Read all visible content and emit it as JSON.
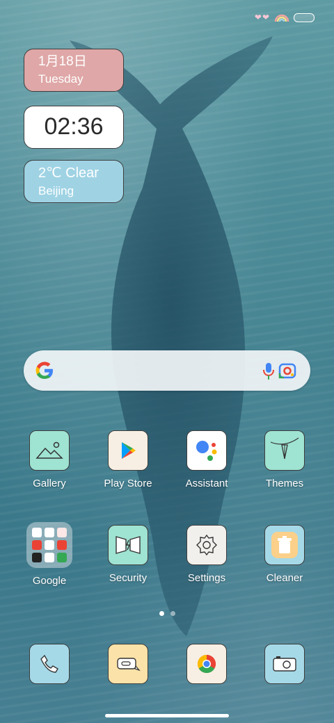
{
  "widgets": {
    "date": {
      "date": "1月18日",
      "weekday": "Tuesday"
    },
    "clock": {
      "time": "02:36"
    },
    "weather": {
      "condition": "2℃ Clear",
      "city": "Beijing"
    }
  },
  "search": {
    "logo_icon": "google-g-icon",
    "voice_icon": "mic-icon",
    "lens_icon": "google-lens-icon"
  },
  "apps": [
    {
      "label": "Gallery",
      "icon": "gallery-icon"
    },
    {
      "label": "Play Store",
      "icon": "play-store-icon"
    },
    {
      "label": "Assistant",
      "icon": "assistant-icon"
    },
    {
      "label": "Themes",
      "icon": "themes-icon"
    },
    {
      "label": "Google",
      "icon": "folder-icon"
    },
    {
      "label": "Security",
      "icon": "security-icon"
    },
    {
      "label": "Settings",
      "icon": "settings-icon"
    },
    {
      "label": "Cleaner",
      "icon": "cleaner-icon"
    }
  ],
  "dock": [
    {
      "icon": "phone-icon"
    },
    {
      "icon": "messages-icon"
    },
    {
      "icon": "chrome-icon"
    },
    {
      "icon": "camera-icon"
    }
  ],
  "pages": {
    "count": 2,
    "current": 1
  },
  "colors": {
    "date_widget": "#dfa7a7",
    "weather_widget": "#9fd3e4",
    "tile_mint": "#9fe3d2",
    "tile_cream": "#f7efe3",
    "tile_blue": "#a6d9e8",
    "tile_yellow": "#fbe2a8"
  }
}
